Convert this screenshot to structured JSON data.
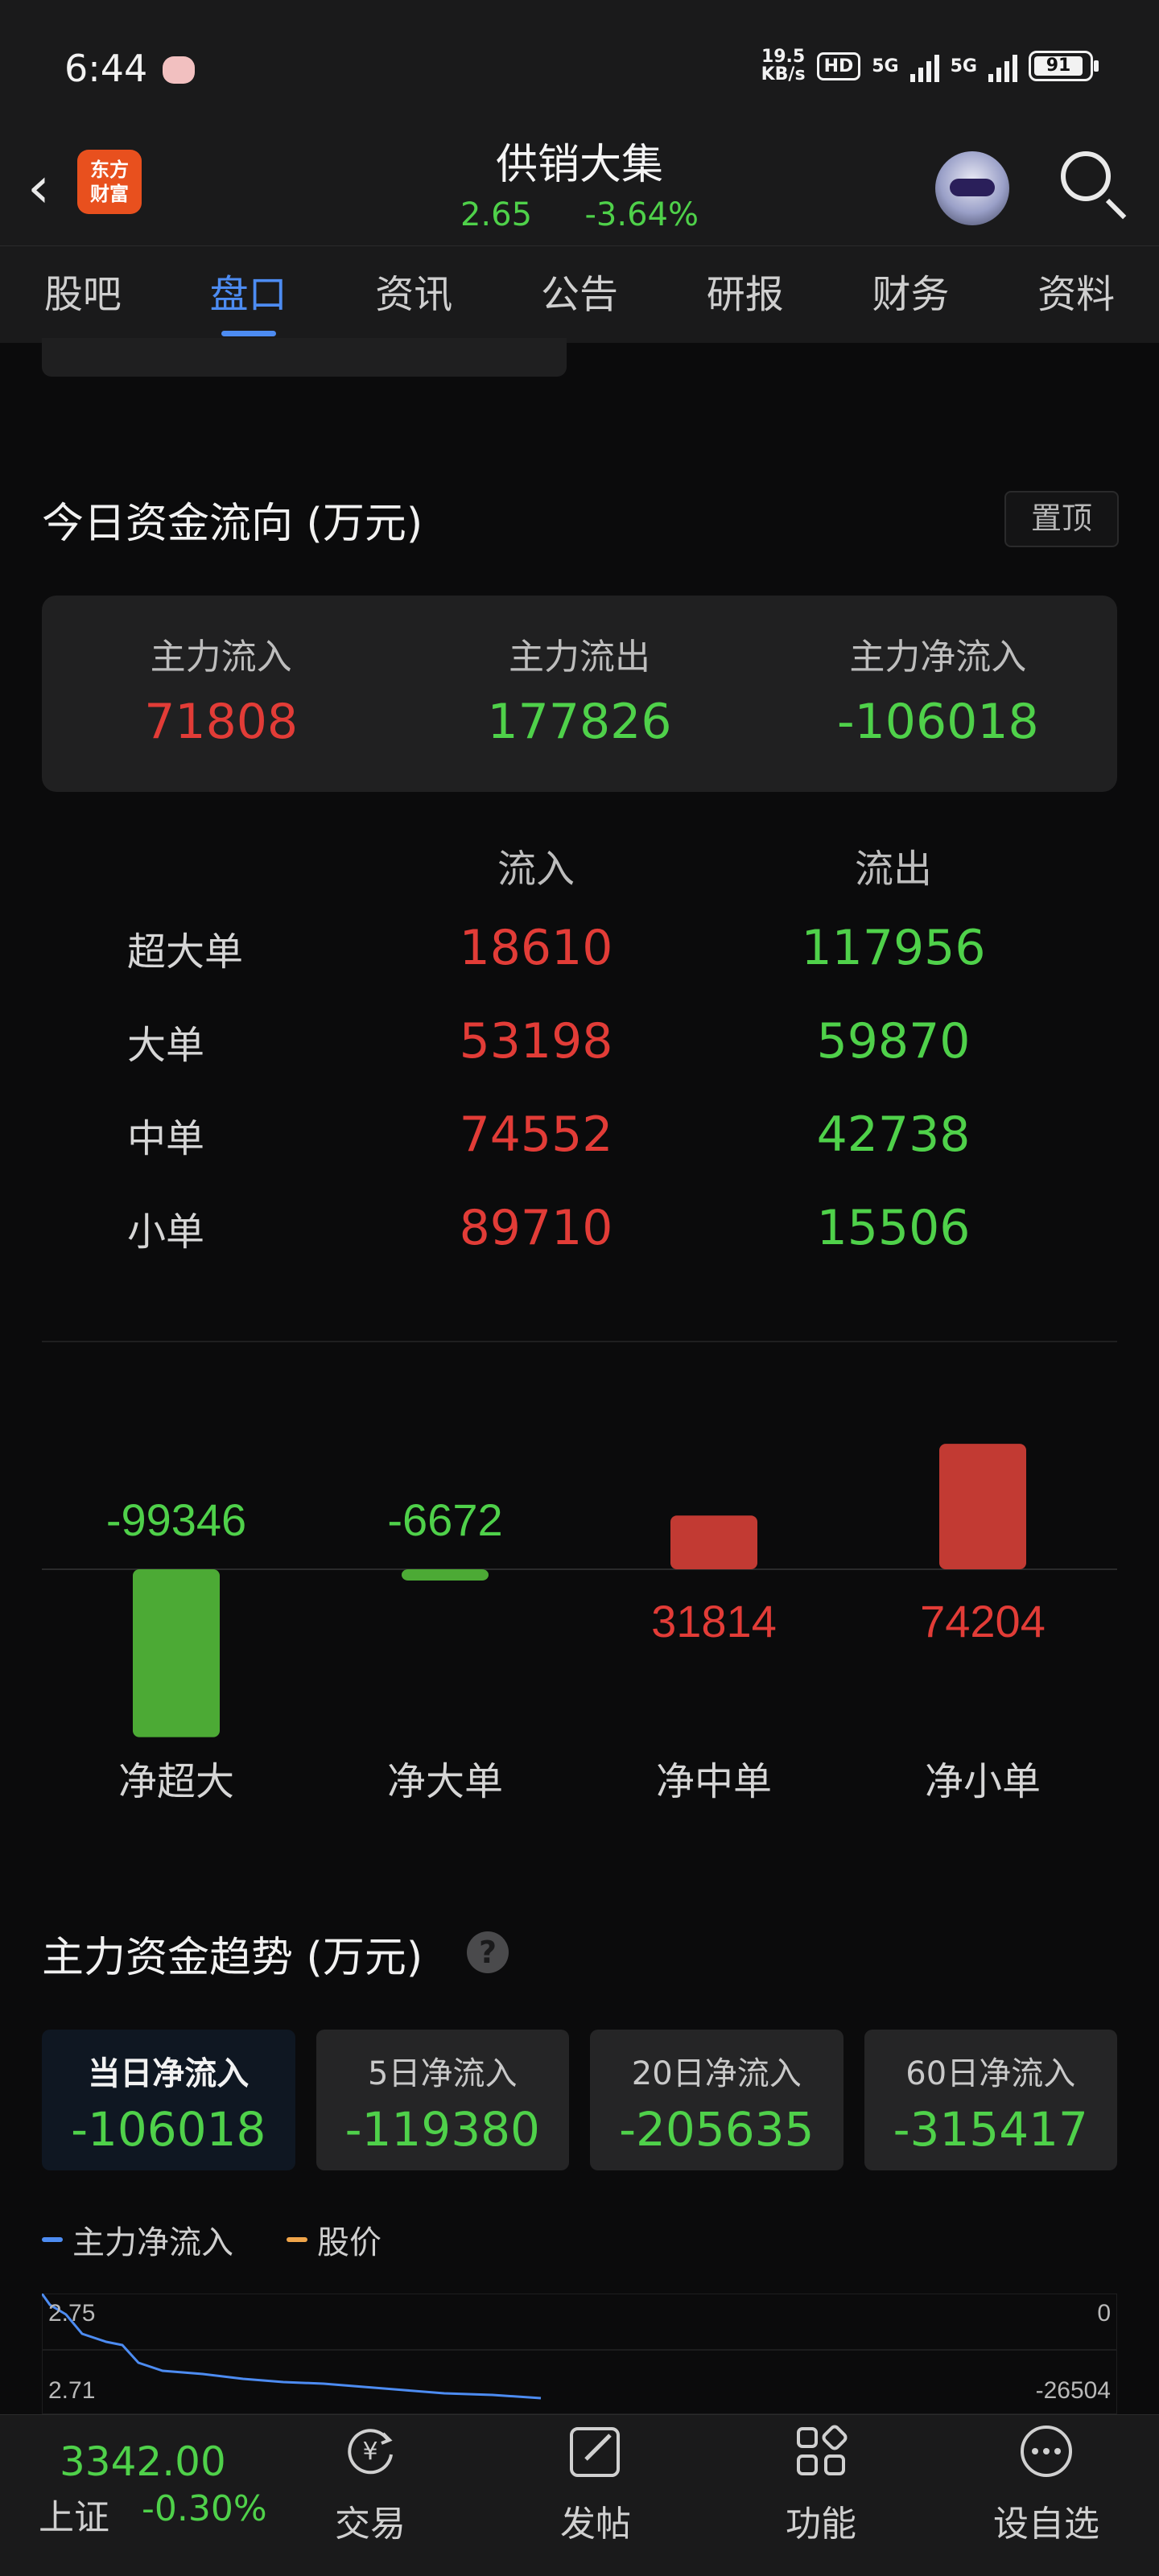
{
  "status_bar": {
    "time": "6:44",
    "net_speed_value": "19.5",
    "net_speed_unit": "KB/s",
    "hd_label": "HD",
    "sim1": "5G",
    "sim2": "5G",
    "battery": "91"
  },
  "header": {
    "logo_line1": "东方",
    "logo_line2": "财富",
    "title": "供销大集",
    "price": "2.65",
    "change": "-3.64%"
  },
  "tabs": [
    {
      "label": "股吧",
      "active": false
    },
    {
      "label": "盘口",
      "active": true
    },
    {
      "label": "资讯",
      "active": false
    },
    {
      "label": "公告",
      "active": false
    },
    {
      "label": "研报",
      "active": false
    },
    {
      "label": "财务",
      "active": false
    },
    {
      "label": "资料",
      "active": false
    }
  ],
  "fund_flow": {
    "title": "今日资金流向 (万元)",
    "pin_label": "置顶",
    "summary": [
      {
        "label": "主力流入",
        "value": "71808",
        "color": "#e23c37"
      },
      {
        "label": "主力流出",
        "value": "177826",
        "color": "#4fd14a"
      },
      {
        "label": "主力净流入",
        "value": "-106018",
        "color": "#4fd14a"
      }
    ],
    "table": {
      "headers": [
        "",
        "流入",
        "流出"
      ],
      "rows": [
        {
          "label": "超大单",
          "in": "18610",
          "out": "117956"
        },
        {
          "label": "大单",
          "in": "53198",
          "out": "59870"
        },
        {
          "label": "中单",
          "in": "74552",
          "out": "42738"
        },
        {
          "label": "小单",
          "in": "89710",
          "out": "15506"
        }
      ]
    }
  },
  "chart_data": {
    "type": "bar",
    "categories": [
      "净超大",
      "净大单",
      "净中单",
      "净小单"
    ],
    "values": [
      -99346,
      -6672,
      31814,
      74204
    ],
    "value_labels": [
      "-99346",
      "-6672",
      "31814",
      "74204"
    ],
    "positive_color": "#c23a33",
    "negative_color": "#4caa35"
  },
  "trend": {
    "title": "主力资金趋势 (万元)",
    "periods": [
      {
        "label": "当日净流入",
        "value": "-106018",
        "active": true
      },
      {
        "label": "5日净流入",
        "value": "-119380",
        "active": false
      },
      {
        "label": "20日净流入",
        "value": "-205635",
        "active": false
      },
      {
        "label": "60日净流入",
        "value": "-315417",
        "active": false
      }
    ],
    "legend": [
      {
        "label": "主力净流入",
        "color": "#4d8cf2"
      },
      {
        "label": "股价",
        "color": "#f0a54a"
      }
    ],
    "left_ticks": [
      "2.75",
      "2.71"
    ],
    "right_ticks": [
      "0",
      "-26504"
    ]
  },
  "bottom_bar": {
    "index_value": "3342.00",
    "index_name": "上证",
    "index_change": "-0.30%",
    "nav": [
      {
        "label": "交易",
        "icon": "trade-icon"
      },
      {
        "label": "发帖",
        "icon": "post-icon"
      },
      {
        "label": "功能",
        "icon": "apps-icon"
      },
      {
        "label": "设自选",
        "icon": "more-icon"
      }
    ]
  }
}
